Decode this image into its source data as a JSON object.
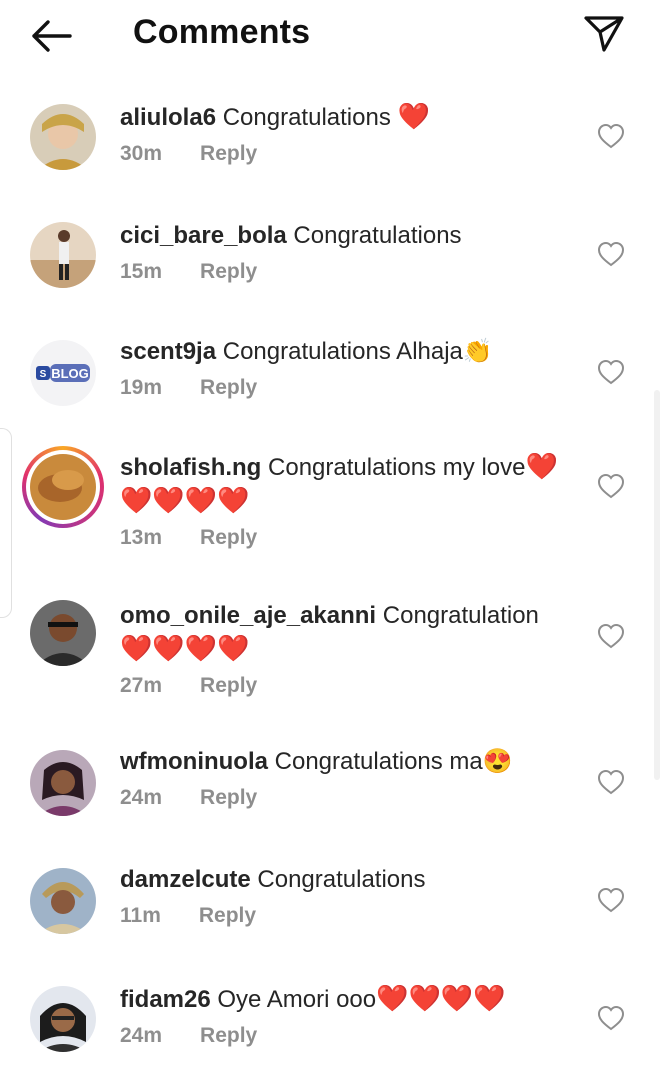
{
  "header": {
    "title": "Comments"
  },
  "reply_label": "Reply",
  "comments": [
    {
      "username": "aliulola6",
      "text": " Congratulations ",
      "trail": "❤️",
      "time": "30m"
    },
    {
      "username": "cici_bare_bola",
      "text": " Congratulations",
      "trail": "",
      "time": "15m"
    },
    {
      "username": "scent9ja",
      "text": " Congratulations Alhaja",
      "trail": "👏",
      "time": "19m"
    },
    {
      "username": "sholafish.ng",
      "text": " Congratulations my love",
      "trail": "❤️❤️❤️❤️❤️",
      "time": "13m"
    },
    {
      "username": "omo_onile_aje_akanni",
      "text": " Congratulation ",
      "trail": "❤️❤️❤️❤️",
      "time": "27m"
    },
    {
      "username": "wfmoninuola",
      "text": " Congratulations ma",
      "trail": "😍",
      "time": "24m"
    },
    {
      "username": "damzelcute",
      "text": " Congratulations",
      "trail": "",
      "time": "11m"
    },
    {
      "username": "fidam26",
      "text": " Oye Amori ooo",
      "trail": "❤️❤️❤️❤️",
      "time": "24m"
    }
  ],
  "colors": {
    "text": "#262626",
    "meta": "#8e8e8e",
    "heart": "#e0161e"
  }
}
